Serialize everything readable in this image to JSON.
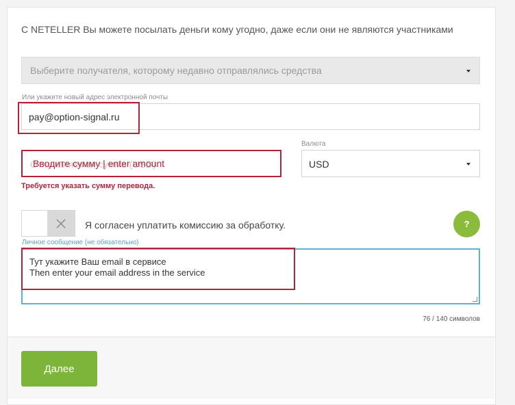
{
  "intro_text": "С NETELLER Вы можете посылать деньги кому угодно, даже если они не являются участниками",
  "recipient_select": {
    "placeholder": "Выберите получателя, которому недавно отправлялись средства",
    "icon": "chevron-down-icon"
  },
  "email": {
    "label": "Или укажите новый адрес электронной почты",
    "value": "pay@option-signal.ru"
  },
  "amount": {
    "placeholder": "Отправляемая сумма (USD)",
    "annotation": "Вводите сумму | enter amount",
    "error": "Требуется указать сумму перевода."
  },
  "currency": {
    "label": "Валюта",
    "value": "USD",
    "icon": "chevron-down-icon"
  },
  "fee_toggle": {
    "label": "Я согласен уплатить комиссию за обработку.",
    "icon": "close-icon"
  },
  "help_button": {
    "label": "?"
  },
  "message": {
    "label": "Личное сообщение (не обязательно)",
    "line1": "Тут укажите Ваш email в сервисе",
    "line2": "Then enter your email address in the service"
  },
  "char_counter": "76 / 140 символов",
  "next_button": {
    "label": "Далее"
  },
  "colors": {
    "accent_green": "#7db53a",
    "error_red": "#b0243a",
    "focus_blue": "#5bb0d6"
  }
}
